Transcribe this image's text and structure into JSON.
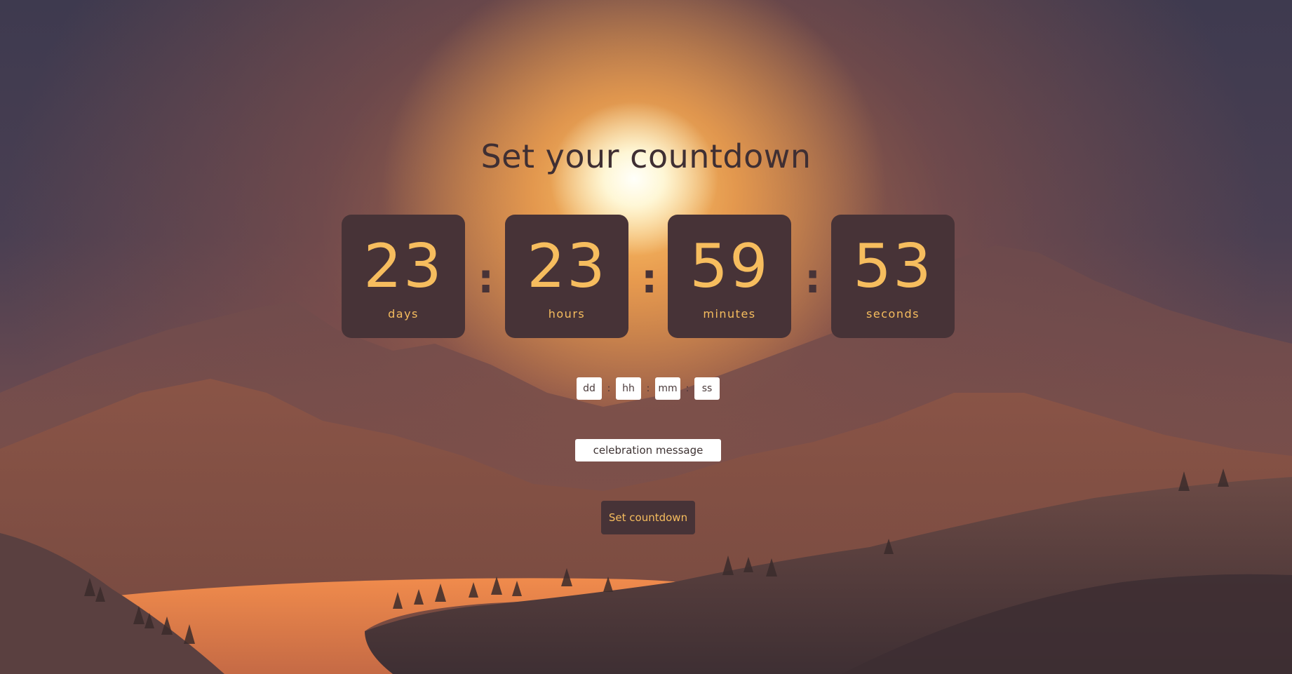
{
  "page": {
    "title": "Set your countdown"
  },
  "countdown": {
    "days": {
      "value": "23",
      "label": "days"
    },
    "hours": {
      "value": "23",
      "label": "hours"
    },
    "minutes": {
      "value": "59",
      "label": "minutes"
    },
    "seconds": {
      "value": "53",
      "label": "seconds"
    },
    "separator": ":"
  },
  "form": {
    "days_placeholder": "dd",
    "hours_placeholder": "hh",
    "minutes_placeholder": "mm",
    "seconds_placeholder": "ss",
    "separator": ":",
    "message_placeholder": "celebration message",
    "submit_label": "Set countdown"
  },
  "colors": {
    "tile_background": "#473337",
    "digit_color": "#f6bd5e",
    "title_color": "#3f2f33"
  }
}
